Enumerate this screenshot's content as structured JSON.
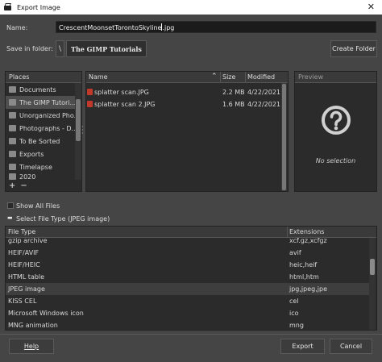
{
  "window": {
    "title": "Export Image"
  },
  "name_row": {
    "label": "Name:",
    "value": "CrescentMoonsetTorontoSkyline",
    "value_after_caret": ".jpg"
  },
  "folder_row": {
    "label": "Save in folder:",
    "crumb_arrow": "\\",
    "crumb": "The GIMP Tutorials",
    "create_folder": "Create Folder"
  },
  "places": {
    "header": "Places",
    "items": [
      {
        "label": "Documents"
      },
      {
        "label": "The GIMP Tutori..."
      },
      {
        "label": "Unorganized Pho..."
      },
      {
        "label": "Photographs - D..."
      },
      {
        "label": "To Be Sorted"
      },
      {
        "label": "Exports"
      },
      {
        "label": "Timelapse"
      },
      {
        "label": "2020"
      }
    ],
    "add": "+",
    "remove": "−"
  },
  "file_list": {
    "columns": {
      "name": "Name",
      "size": "Size",
      "modified": "Modified"
    },
    "rows": [
      {
        "name": "splatter scan.JPG",
        "size": "2.2 MB",
        "modified": "4/22/2021"
      },
      {
        "name": "splatter scan 2.JPG",
        "size": "1.6 MB",
        "modified": "4/22/2021"
      }
    ]
  },
  "preview": {
    "header": "Preview",
    "empty": "No selection",
    "icon": "question-circle-icon"
  },
  "show_all_files": "Show All Files",
  "select_file_type": "Select File Type (JPEG image)",
  "file_types": {
    "columns": {
      "type": "File Type",
      "ext": "Extensions"
    },
    "rows": [
      {
        "type": "gzip archive",
        "ext": "xcf.gz,xcfgz"
      },
      {
        "type": "HEIF/AVIF",
        "ext": "avif"
      },
      {
        "type": "HEIF/HEIC",
        "ext": "heic,heif"
      },
      {
        "type": "HTML table",
        "ext": "html,htm"
      },
      {
        "type": "JPEG image",
        "ext": "jpg,jpeg,jpe"
      },
      {
        "type": "KISS CEL",
        "ext": "cel"
      },
      {
        "type": "Microsoft Windows icon",
        "ext": "ico"
      },
      {
        "type": "MNG animation",
        "ext": "mng"
      }
    ]
  },
  "buttons": {
    "help": "Help",
    "export": "Export",
    "cancel": "Cancel"
  }
}
